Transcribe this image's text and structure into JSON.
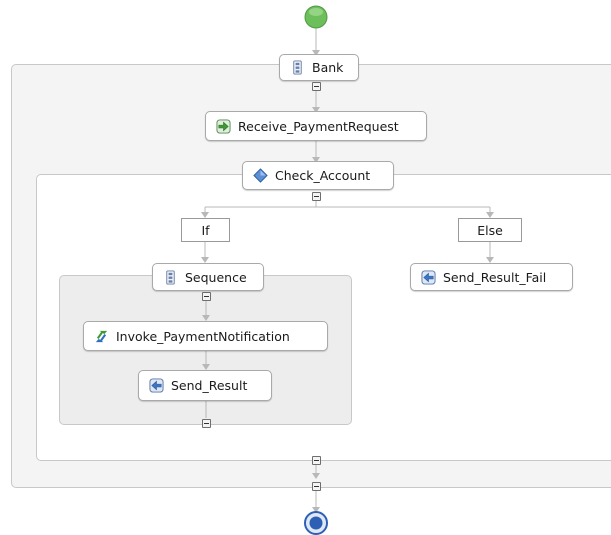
{
  "process": {
    "bank_label": "Bank",
    "receive_label": "Receive_PaymentRequest",
    "check_label": "Check_Account",
    "if_label": "If",
    "else_label": "Else",
    "sequence_label": "Sequence",
    "invoke_label": "Invoke_PaymentNotification",
    "send_result_label": "Send_Result",
    "send_fail_label": "Send_Result_Fail"
  },
  "icons": {
    "start": "start-event-icon",
    "end": "end-event-icon",
    "sequence": "sequence-icon",
    "receive": "receive-icon",
    "if": "if-diamond-icon",
    "invoke": "invoke-icon",
    "reply": "reply-icon"
  },
  "colors": {
    "start_fill": "#6cbf5a",
    "end_fill": "#2d5fb5",
    "scope_bank_bg": "#f4f4f4",
    "scope_check_bg": "#ffffff",
    "scope_sequence_bg": "#ededed",
    "connector": "#b8b8b8"
  }
}
